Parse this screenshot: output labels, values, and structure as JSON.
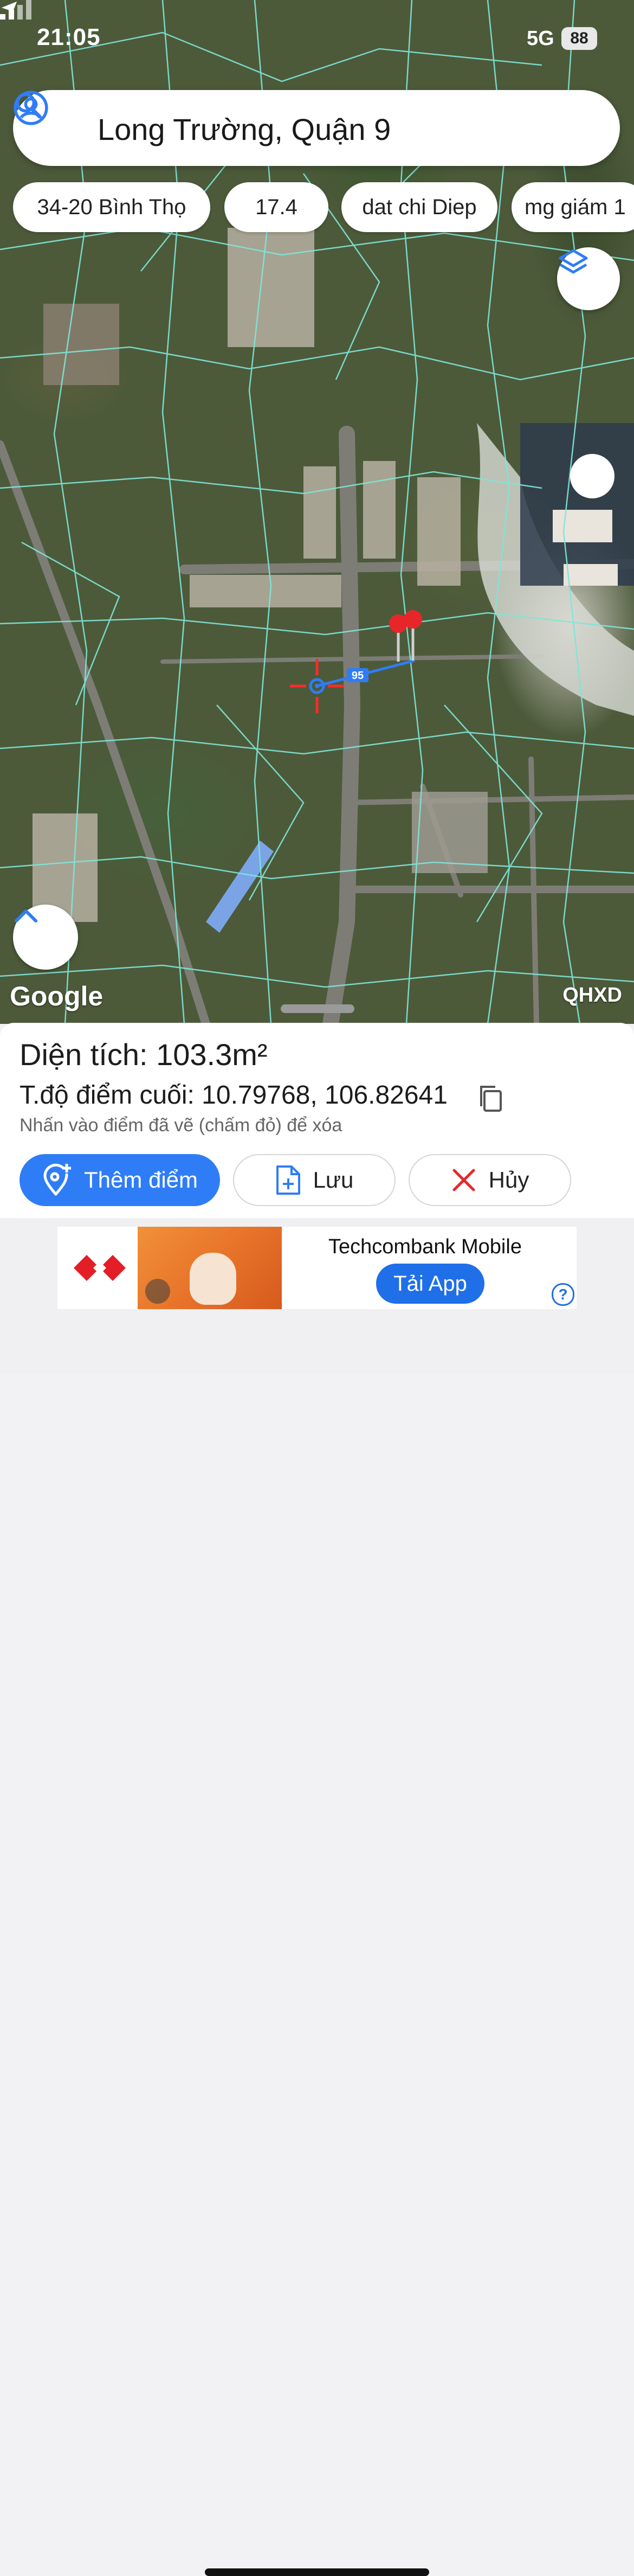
{
  "status_bar": {
    "time": "21:05",
    "network": "5G",
    "battery": "88"
  },
  "search": {
    "query": "Long Trường, Quận 9"
  },
  "chips": [
    {
      "label": "34-20 Bình Thọ"
    },
    {
      "label": "17.4"
    },
    {
      "label": "dat chi Diep"
    },
    {
      "label": "mg giám 1"
    }
  ],
  "map": {
    "distance_label": "95",
    "attribution": "Google",
    "layer_label": "QHXD",
    "parcel_line_color": "#7fe6d8",
    "measure_color": "#2f7df6",
    "pin_color": "#e8262a",
    "crosshair_color": "#ff2a2a"
  },
  "panel": {
    "area_label": "Diện tích:",
    "area_value": "103.3m²",
    "coord_label": "T.độ điểm cuối:",
    "coord_value": "10.79768, 106.82641",
    "hint": "Nhấn vào điểm đã vẽ (chấm đỏ) để xóa",
    "add_point_label": "Thêm điểm",
    "save_label": "Lưu",
    "cancel_label": "Hủy"
  },
  "ad": {
    "title": "Techcombank Mobile",
    "cta": "Tải App",
    "info": "?"
  }
}
